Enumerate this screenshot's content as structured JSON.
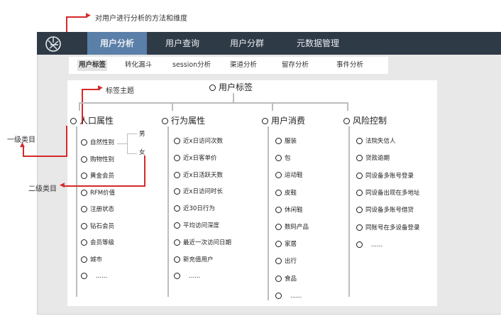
{
  "annotations": {
    "top": "对用户进行分析的方法和维度",
    "tag_theme": "标签主题",
    "level1": "一级类目",
    "level2": "二级类目"
  },
  "colors": {
    "annotation": "#d42a2a",
    "topbar": "#2f3a47",
    "active_tab": "#5a7fa8"
  },
  "app": {
    "logo_icon": "aperture-logo-icon",
    "nav_tabs": [
      {
        "label": "用户分析",
        "active": true
      },
      {
        "label": "用户查询",
        "active": false
      },
      {
        "label": "用户分群",
        "active": false
      },
      {
        "label": "元数据管理",
        "active": false
      }
    ],
    "sub_tabs": [
      {
        "label": "用户标签",
        "active": true
      },
      {
        "label": "转化漏斗",
        "active": false
      },
      {
        "label": "session分析",
        "active": false
      },
      {
        "label": "渠道分析",
        "active": false
      },
      {
        "label": "留存分析",
        "active": false
      },
      {
        "label": "事件分析",
        "active": false
      }
    ]
  },
  "tree": {
    "root": "用户标签",
    "categories": [
      {
        "label": "人口属性",
        "items": [
          "自然性别",
          "购物性别",
          "黄金会员",
          "RFM价值",
          "注册状态",
          "钻石会员",
          "会员等级",
          "城市",
          "......"
        ],
        "gender_values": [
          "男",
          "女"
        ]
      },
      {
        "label": "行为属性",
        "items": [
          "近x日访问次数",
          "近x日客单价",
          "近x日活跃天数",
          "近x日访问时长",
          "近30日行为",
          "平均访问深度",
          "最近一次访问日期",
          "新充值用户",
          "......"
        ]
      },
      {
        "label": "用户消费",
        "items": [
          "服装",
          "包",
          "运动鞋",
          "皮鞋",
          "休闲鞋",
          "数码产品",
          "家居",
          "出行",
          "食品",
          "......"
        ]
      },
      {
        "label": "风险控制",
        "items": [
          "法院失信人",
          "贷款逾期",
          "同设备多账号登录",
          "同设备出现在多地址",
          "同设备多账号借贷",
          "同账号在多设备登录",
          "......"
        ]
      }
    ]
  }
}
